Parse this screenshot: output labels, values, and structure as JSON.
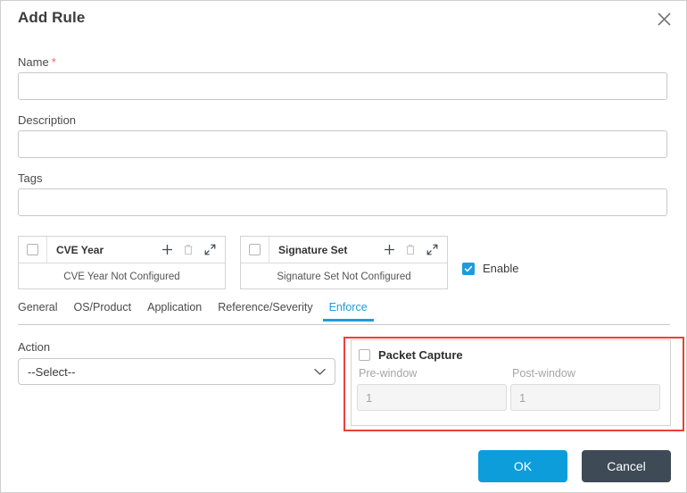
{
  "dialog": {
    "title": "Add Rule",
    "close_icon": "close-icon"
  },
  "form": {
    "name": {
      "label": "Name",
      "required_marker": "*",
      "value": "",
      "placeholder": ""
    },
    "description": {
      "label": "Description",
      "value": "",
      "placeholder": ""
    },
    "tags": {
      "label": "Tags",
      "value": "",
      "placeholder": ""
    }
  },
  "config_panels": [
    {
      "title": "CVE Year",
      "empty_message": "CVE Year Not Configured",
      "checkbox_checked": false,
      "icons": [
        "plus-icon",
        "trash-icon",
        "expand-icon"
      ]
    },
    {
      "title": "Signature Set",
      "empty_message": "Signature Set Not Configured",
      "checkbox_checked": false,
      "icons": [
        "plus-icon",
        "trash-icon",
        "expand-icon"
      ]
    }
  ],
  "enable": {
    "label": "Enable",
    "checked": true
  },
  "tabs": [
    {
      "label": "General",
      "active": false
    },
    {
      "label": "OS/Product",
      "active": false
    },
    {
      "label": "Application",
      "active": false
    },
    {
      "label": "Reference/Severity",
      "active": false
    },
    {
      "label": "Enforce",
      "active": true
    }
  ],
  "enforce": {
    "action": {
      "label": "Action",
      "selected": "--Select--",
      "chevron_icon": "chevron-down-icon"
    },
    "packet_capture": {
      "label": "Packet Capture",
      "checked": false,
      "highlighted": true,
      "pre_window": {
        "label": "Pre-window",
        "value": "1",
        "disabled": true
      },
      "post_window": {
        "label": "Post-window",
        "value": "1",
        "disabled": true
      }
    }
  },
  "footer": {
    "ok_label": "OK",
    "cancel_label": "Cancel"
  },
  "colors": {
    "accent_blue": "#1f9bdd",
    "ok_button": "#0d9ddb",
    "cancel_button": "#3e4a56",
    "highlight_red": "#ef3f35",
    "required_star": "#f4626c"
  }
}
